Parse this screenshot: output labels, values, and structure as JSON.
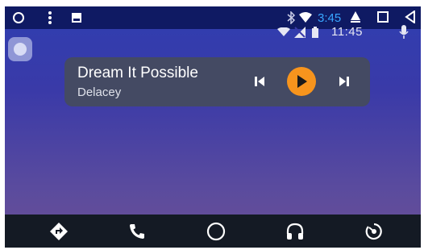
{
  "status_bar": {
    "time": "3:45",
    "icons": [
      "circle-icon",
      "more-vert-icon",
      "notification-image-icon",
      "bluetooth-icon",
      "wifi-icon",
      "home-triangle-icon",
      "square-icon",
      "back-triangle-icon"
    ]
  },
  "secondary_status": {
    "time": "11:45",
    "icons": [
      "wifi-icon",
      "no-signal-icon",
      "battery-icon",
      "mic-icon"
    ]
  },
  "media": {
    "title": "Dream It Possible",
    "artist": "Delacey",
    "controls": [
      "skip-previous-icon",
      "play-icon",
      "skip-next-icon"
    ],
    "accent_color": "#f7941d"
  },
  "nav": {
    "items": [
      "navigation-icon",
      "phone-icon",
      "home-circle-icon",
      "headphones-icon",
      "exit-icon"
    ]
  },
  "colors": {
    "status_bar": "#0f1a63",
    "bottom_bar": "#141a24",
    "card": "#444a63"
  }
}
